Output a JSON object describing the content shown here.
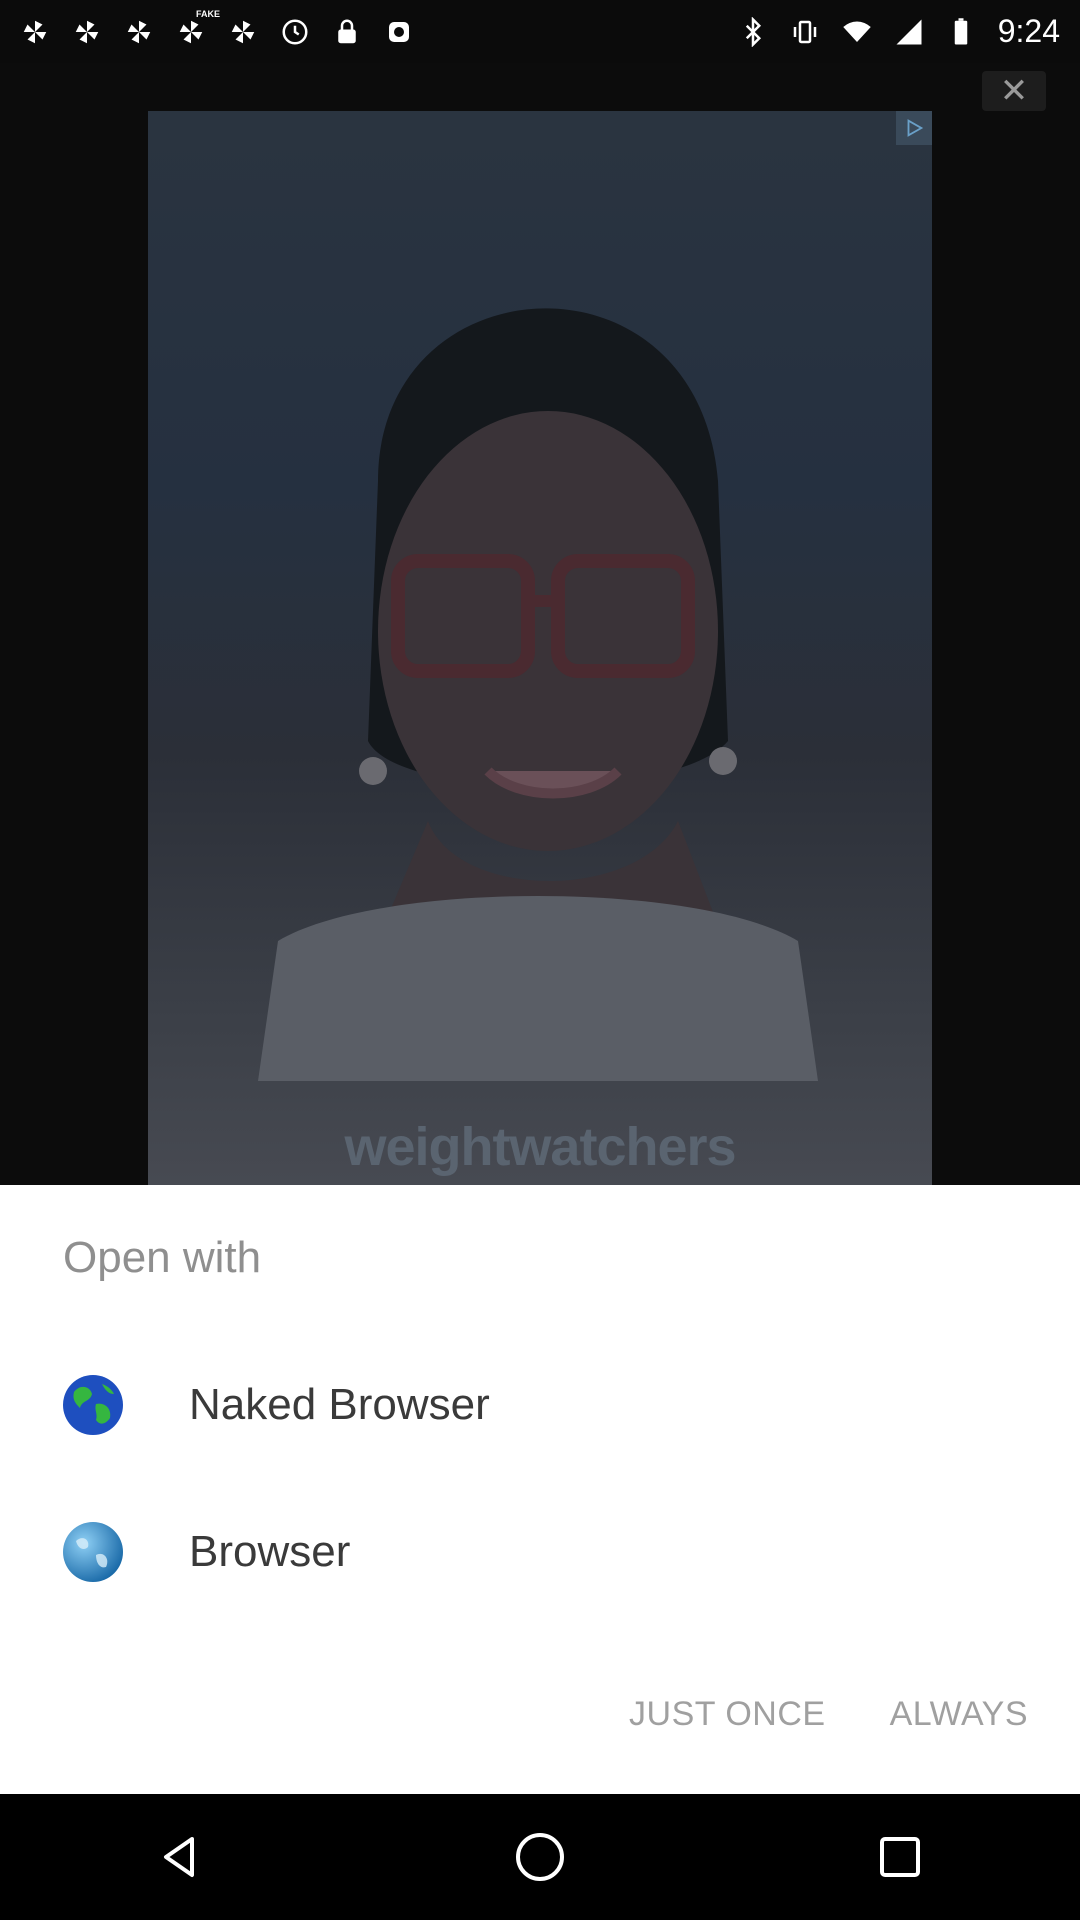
{
  "status_bar": {
    "time": "9:24",
    "fake_label": "FAKE",
    "left_icons": [
      "pinwheel-icon",
      "pinwheel-icon",
      "pinwheel-icon",
      "pinwheel-icon",
      "pinwheel-icon",
      "clock-sync-icon",
      "lock-icon",
      "app-notification-icon"
    ],
    "right_icons": [
      "bluetooth-icon",
      "vibrate-icon",
      "wifi-icon",
      "signal-icon",
      "battery-icon"
    ]
  },
  "background_ad": {
    "close_symbol": "✕",
    "brand_text": "weightwatchers"
  },
  "chooser": {
    "title": "Open with",
    "apps": [
      {
        "label": "Naked Browser",
        "icon": "globe-green-icon"
      },
      {
        "label": "Browser",
        "icon": "globe-blue-icon"
      }
    ],
    "just_once_label": "JUST ONCE",
    "always_label": "ALWAYS"
  },
  "nav_bar": {
    "icons": [
      "back-icon",
      "home-icon",
      "recents-icon"
    ]
  },
  "colors": {
    "sheet_background": "#ffffff",
    "title_text": "#8f8f8f",
    "button_text": "#a0a0a0",
    "dim_overlay": "#000000"
  }
}
